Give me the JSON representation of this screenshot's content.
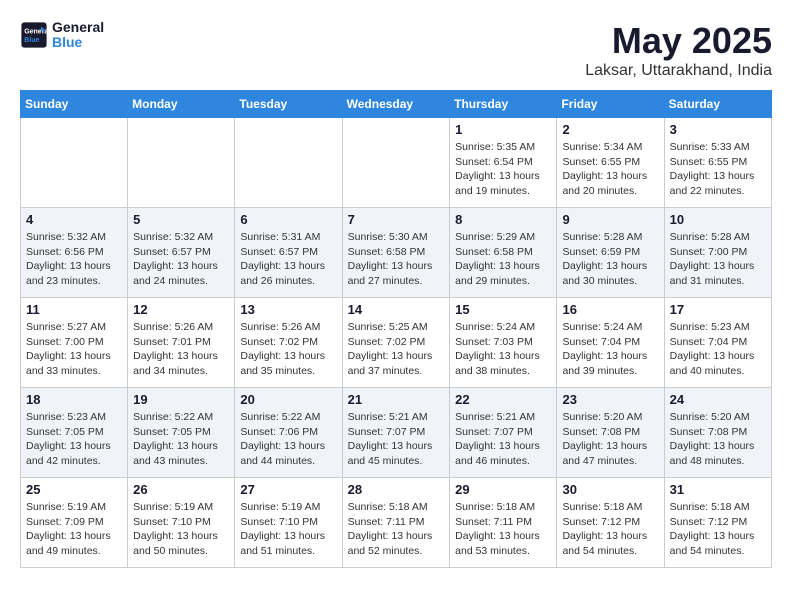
{
  "header": {
    "logo_line1": "General",
    "logo_line2": "Blue",
    "month_title": "May 2025",
    "location": "Laksar, Uttarakhand, India"
  },
  "weekdays": [
    "Sunday",
    "Monday",
    "Tuesday",
    "Wednesday",
    "Thursday",
    "Friday",
    "Saturday"
  ],
  "weeks": [
    [
      {
        "day": "",
        "info": ""
      },
      {
        "day": "",
        "info": ""
      },
      {
        "day": "",
        "info": ""
      },
      {
        "day": "",
        "info": ""
      },
      {
        "day": "1",
        "info": "Sunrise: 5:35 AM\nSunset: 6:54 PM\nDaylight: 13 hours\nand 19 minutes."
      },
      {
        "day": "2",
        "info": "Sunrise: 5:34 AM\nSunset: 6:55 PM\nDaylight: 13 hours\nand 20 minutes."
      },
      {
        "day": "3",
        "info": "Sunrise: 5:33 AM\nSunset: 6:55 PM\nDaylight: 13 hours\nand 22 minutes."
      }
    ],
    [
      {
        "day": "4",
        "info": "Sunrise: 5:32 AM\nSunset: 6:56 PM\nDaylight: 13 hours\nand 23 minutes."
      },
      {
        "day": "5",
        "info": "Sunrise: 5:32 AM\nSunset: 6:57 PM\nDaylight: 13 hours\nand 24 minutes."
      },
      {
        "day": "6",
        "info": "Sunrise: 5:31 AM\nSunset: 6:57 PM\nDaylight: 13 hours\nand 26 minutes."
      },
      {
        "day": "7",
        "info": "Sunrise: 5:30 AM\nSunset: 6:58 PM\nDaylight: 13 hours\nand 27 minutes."
      },
      {
        "day": "8",
        "info": "Sunrise: 5:29 AM\nSunset: 6:58 PM\nDaylight: 13 hours\nand 29 minutes."
      },
      {
        "day": "9",
        "info": "Sunrise: 5:28 AM\nSunset: 6:59 PM\nDaylight: 13 hours\nand 30 minutes."
      },
      {
        "day": "10",
        "info": "Sunrise: 5:28 AM\nSunset: 7:00 PM\nDaylight: 13 hours\nand 31 minutes."
      }
    ],
    [
      {
        "day": "11",
        "info": "Sunrise: 5:27 AM\nSunset: 7:00 PM\nDaylight: 13 hours\nand 33 minutes."
      },
      {
        "day": "12",
        "info": "Sunrise: 5:26 AM\nSunset: 7:01 PM\nDaylight: 13 hours\nand 34 minutes."
      },
      {
        "day": "13",
        "info": "Sunrise: 5:26 AM\nSunset: 7:02 PM\nDaylight: 13 hours\nand 35 minutes."
      },
      {
        "day": "14",
        "info": "Sunrise: 5:25 AM\nSunset: 7:02 PM\nDaylight: 13 hours\nand 37 minutes."
      },
      {
        "day": "15",
        "info": "Sunrise: 5:24 AM\nSunset: 7:03 PM\nDaylight: 13 hours\nand 38 minutes."
      },
      {
        "day": "16",
        "info": "Sunrise: 5:24 AM\nSunset: 7:04 PM\nDaylight: 13 hours\nand 39 minutes."
      },
      {
        "day": "17",
        "info": "Sunrise: 5:23 AM\nSunset: 7:04 PM\nDaylight: 13 hours\nand 40 minutes."
      }
    ],
    [
      {
        "day": "18",
        "info": "Sunrise: 5:23 AM\nSunset: 7:05 PM\nDaylight: 13 hours\nand 42 minutes."
      },
      {
        "day": "19",
        "info": "Sunrise: 5:22 AM\nSunset: 7:05 PM\nDaylight: 13 hours\nand 43 minutes."
      },
      {
        "day": "20",
        "info": "Sunrise: 5:22 AM\nSunset: 7:06 PM\nDaylight: 13 hours\nand 44 minutes."
      },
      {
        "day": "21",
        "info": "Sunrise: 5:21 AM\nSunset: 7:07 PM\nDaylight: 13 hours\nand 45 minutes."
      },
      {
        "day": "22",
        "info": "Sunrise: 5:21 AM\nSunset: 7:07 PM\nDaylight: 13 hours\nand 46 minutes."
      },
      {
        "day": "23",
        "info": "Sunrise: 5:20 AM\nSunset: 7:08 PM\nDaylight: 13 hours\nand 47 minutes."
      },
      {
        "day": "24",
        "info": "Sunrise: 5:20 AM\nSunset: 7:08 PM\nDaylight: 13 hours\nand 48 minutes."
      }
    ],
    [
      {
        "day": "25",
        "info": "Sunrise: 5:19 AM\nSunset: 7:09 PM\nDaylight: 13 hours\nand 49 minutes."
      },
      {
        "day": "26",
        "info": "Sunrise: 5:19 AM\nSunset: 7:10 PM\nDaylight: 13 hours\nand 50 minutes."
      },
      {
        "day": "27",
        "info": "Sunrise: 5:19 AM\nSunset: 7:10 PM\nDaylight: 13 hours\nand 51 minutes."
      },
      {
        "day": "28",
        "info": "Sunrise: 5:18 AM\nSunset: 7:11 PM\nDaylight: 13 hours\nand 52 minutes."
      },
      {
        "day": "29",
        "info": "Sunrise: 5:18 AM\nSunset: 7:11 PM\nDaylight: 13 hours\nand 53 minutes."
      },
      {
        "day": "30",
        "info": "Sunrise: 5:18 AM\nSunset: 7:12 PM\nDaylight: 13 hours\nand 54 minutes."
      },
      {
        "day": "31",
        "info": "Sunrise: 5:18 AM\nSunset: 7:12 PM\nDaylight: 13 hours\nand 54 minutes."
      }
    ]
  ]
}
